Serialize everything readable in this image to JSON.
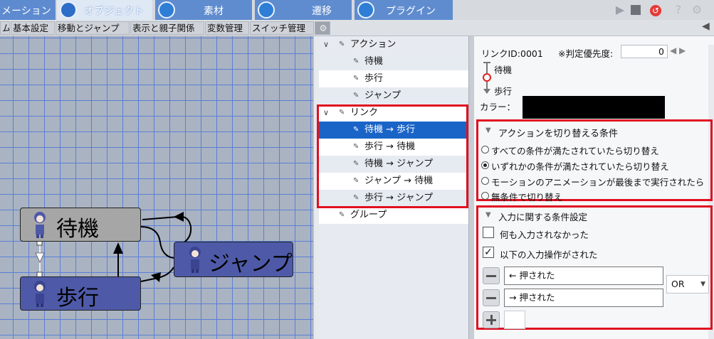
{
  "top_tabs": [
    {
      "label": "メーション",
      "icon": "",
      "active": false
    },
    {
      "label": "オブジェクト",
      "icon": "object-cube-icon",
      "active": true
    },
    {
      "label": "素材",
      "icon": "layers-icon",
      "active": false
    },
    {
      "label": "遷移",
      "icon": "transition-icon",
      "active": false
    },
    {
      "label": "プラグイン",
      "icon": "puzzle-icon",
      "active": false
    }
  ],
  "toolbar": {
    "play_icon": "play-icon",
    "stop_icon": "stop-icon",
    "undo_icon": "undo-icon",
    "help_icon": "help-icon",
    "settings_icon": "gear-icon"
  },
  "sub_tabs": [
    "ム",
    "基本設定",
    "移動とジャンプ",
    "表示と親子関係",
    "変数管理",
    "スイッチ管理"
  ],
  "graph": {
    "nodes": [
      {
        "label": "待機",
        "color": "#a6a6a6"
      },
      {
        "label": "歩行",
        "color": "#4e5aa8"
      },
      {
        "label": "ジャンプ",
        "color": "#4e5aa8"
      }
    ]
  },
  "tree": {
    "items": [
      {
        "label": "アクション",
        "level": 0,
        "expandable": true
      },
      {
        "label": "待機",
        "level": 1
      },
      {
        "label": "歩行",
        "level": 1
      },
      {
        "label": "ジャンプ",
        "level": 1
      },
      {
        "label": "リンク",
        "level": 0,
        "expandable": true
      },
      {
        "label": "待機 → 歩行",
        "level": 1,
        "selected": true
      },
      {
        "label": "歩行 → 待機",
        "level": 1
      },
      {
        "label": "待機 → ジャンプ",
        "level": 1
      },
      {
        "label": "ジャンプ → 待機",
        "level": 1
      },
      {
        "label": "歩行 → ジャンプ",
        "level": 1
      },
      {
        "label": "グループ",
        "level": 0
      }
    ]
  },
  "link_panel": {
    "link_id_label": "リンクID:0001",
    "priority_label": "※判定優先度:",
    "priority_value": "0",
    "from_label": "待機",
    "to_label": "歩行",
    "color_label": "カラー：",
    "color_value": "#000000"
  },
  "switch_conditions": {
    "header": "アクションを切り替える条件",
    "options": [
      {
        "label": "すべての条件が満たされていたら切り替え",
        "checked": false
      },
      {
        "label": "いずれかの条件が満たされていたら切り替え",
        "checked": true
      },
      {
        "label": "モーションのアニメーションが最後まで実行されたら",
        "checked": false
      },
      {
        "label": "無条件で切り替え",
        "checked": false
      }
    ]
  },
  "input_conditions": {
    "header": "入力に関する条件設定",
    "no_input_label": "何も入力されなかった",
    "no_input_checked": false,
    "input_done_label": "以下の入力操作がされた",
    "input_done_checked": true,
    "inputs": [
      "← 押された",
      "→ 押された"
    ],
    "operator": "OR"
  },
  "highlight_color": "#e01020"
}
